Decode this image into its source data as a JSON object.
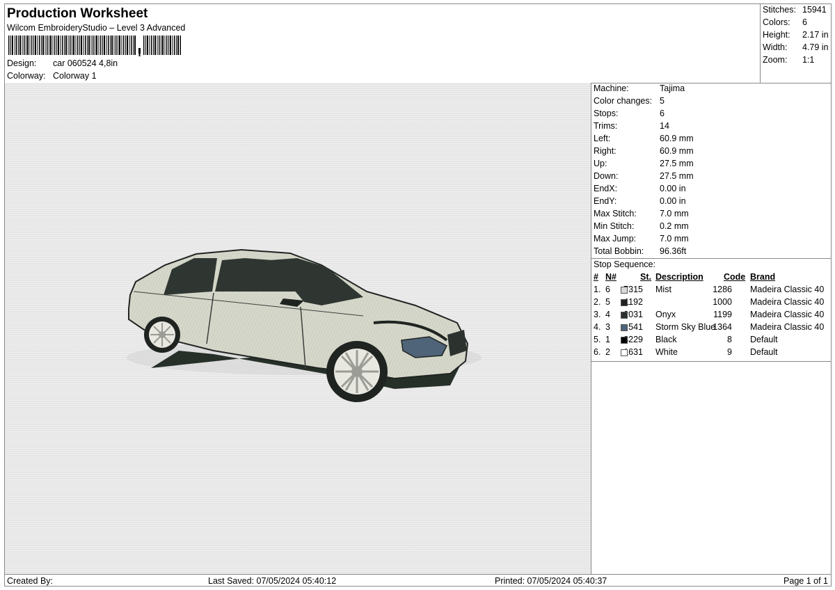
{
  "header": {
    "title": "Production Worksheet",
    "subtitle": "Wilcom EmbroideryStudio – Level 3 Advanced",
    "design_label": "Design:",
    "design_value": "car 060524 4,8in",
    "colorway_label": "Colorway:",
    "colorway_value": "Colorway 1"
  },
  "summary": [
    {
      "label": "Stitches:",
      "value": "15941"
    },
    {
      "label": "Colors:",
      "value": "6"
    },
    {
      "label": "Height:",
      "value": "2.17 in"
    },
    {
      "label": "Width:",
      "value": "4.79 in"
    },
    {
      "label": "Zoom:",
      "value": "1:1"
    }
  ],
  "machine_info": [
    {
      "label": "Machine:",
      "value": "Tajima"
    },
    {
      "label": "Color changes:",
      "value": "5"
    },
    {
      "label": "Stops:",
      "value": "6"
    },
    {
      "label": "Trims:",
      "value": "14"
    },
    {
      "label": "Left:",
      "value": "60.9 mm"
    },
    {
      "label": "Right:",
      "value": "60.9 mm"
    },
    {
      "label": "Up:",
      "value": "27.5 mm"
    },
    {
      "label": "Down:",
      "value": "27.5 mm"
    },
    {
      "label": "EndX:",
      "value": "0.00 in"
    },
    {
      "label": "EndY:",
      "value": "0.00 in"
    },
    {
      "label": "Max Stitch:",
      "value": "7.0 mm"
    },
    {
      "label": "Min Stitch:",
      "value": "0.2 mm"
    },
    {
      "label": "Max Jump:",
      "value": "7.0 mm"
    },
    {
      "label": "Total Bobbin:",
      "value": "96.36ft"
    }
  ],
  "stop_sequence": {
    "title": "Stop Sequence:",
    "headers": {
      "num": "#",
      "n": "N#",
      "st": "St.",
      "description": "Description",
      "code": "Code",
      "brand": "Brand"
    },
    "rows": [
      {
        "num": "1.",
        "n": "6",
        "color": "#d9d9d6",
        "st": "7315",
        "description": "Mist",
        "code": "1286",
        "brand": "Madeira Classic 40"
      },
      {
        "num": "2.",
        "n": "5",
        "color": "#1f2421",
        "st": "1192",
        "description": "",
        "code": "1000",
        "brand": "Madeira Classic 40"
      },
      {
        "num": "3.",
        "n": "4",
        "color": "#2b302d",
        "st": "2031",
        "description": "Onyx",
        "code": "1199",
        "brand": "Madeira Classic 40"
      },
      {
        "num": "4.",
        "n": "3",
        "color": "#4f6478",
        "st": "541",
        "description": "Storm Sky Blue",
        "code": "1364",
        "brand": "Madeira Classic 40"
      },
      {
        "num": "5.",
        "n": "1",
        "color": "#000000",
        "st": "3229",
        "description": "Black",
        "code": "8",
        "brand": "Default"
      },
      {
        "num": "6.",
        "n": "2",
        "color": "#ffffff",
        "st": "1631",
        "description": "White",
        "code": "9",
        "brand": "Default"
      }
    ]
  },
  "footer": {
    "created_by": "Created By:",
    "last_saved": "Last Saved: 07/05/2024 05:40:12",
    "printed": "Printed: 07/05/2024 05:40:37",
    "page": "Page 1 of 1"
  }
}
